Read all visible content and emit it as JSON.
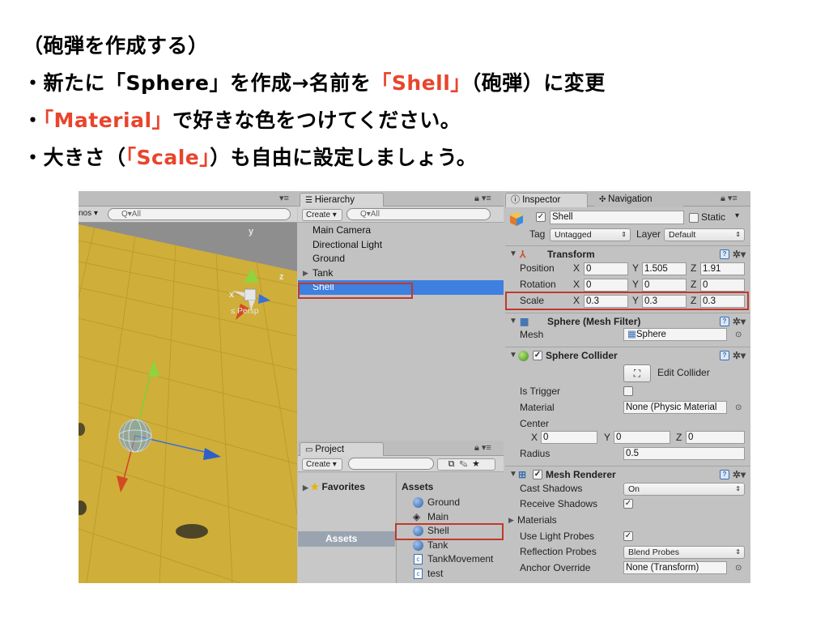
{
  "slide": {
    "heading": "（砲弾を作成する）",
    "bullet1": {
      "pre": "・新たに「Sphere」を作成→名前を",
      "hl": "「Shell」",
      "post": "（砲弾）に変更"
    },
    "bullet2": {
      "pre": "・",
      "hl": "「Material」",
      "post": "で好きな色をつけてください。"
    },
    "bullet3": {
      "pre": "・大きさ（",
      "hl": "「Scale」",
      "post": "）も自由に設定しましょう。"
    },
    "highlight_color": "#e8452c"
  },
  "scene": {
    "gizmos_label": "nos ▾",
    "search_placeholder": "Q▾All",
    "axis_y": "y",
    "axis_z": "z",
    "axis_x": "x",
    "persp_label": "≤ Persp"
  },
  "hierarchy": {
    "tab_label": "Hierarchy",
    "create_label": "Create ▾",
    "search_placeholder": "Q▾All",
    "items": [
      {
        "label": "Main Camera"
      },
      {
        "label": "Directional Light"
      },
      {
        "label": "Ground"
      },
      {
        "label": "Tank"
      },
      {
        "label": "Shell"
      }
    ]
  },
  "project": {
    "tab_label": "Project",
    "create_label": "Create ▾",
    "favorites_label": "Favorites",
    "assets_folder_label": "Assets",
    "assets_heading": "Assets",
    "items": [
      {
        "label": "Ground",
        "icon": "sphere-icon"
      },
      {
        "label": "Main",
        "icon": "unity-scene-icon"
      },
      {
        "label": "Shell",
        "icon": "sphere-icon"
      },
      {
        "label": "Tank",
        "icon": "sphere-icon"
      },
      {
        "label": "TankMovement",
        "icon": "script-icon"
      },
      {
        "label": "test",
        "icon": "script-icon"
      }
    ]
  },
  "inspector": {
    "tab_label": "Inspector",
    "nav_tab_label": "Navigation",
    "object_name": "Shell",
    "static_label": "Static",
    "tag_label": "Tag",
    "tag_value": "Untagged",
    "layer_label": "Layer",
    "layer_value": "Default",
    "transform": {
      "title": "Transform",
      "position_label": "Position",
      "rotation_label": "Rotation",
      "scale_label": "Scale",
      "position": {
        "x": "0",
        "y": "1.505",
        "z": "1.91"
      },
      "rotation": {
        "x": "0",
        "y": "0",
        "z": "0"
      },
      "scale": {
        "x": "0.3",
        "y": "0.3",
        "z": "0.3"
      }
    },
    "mesh_filter": {
      "title": "Sphere (Mesh Filter)",
      "mesh_label": "Mesh",
      "mesh_value": "Sphere"
    },
    "collider": {
      "title": "Sphere Collider",
      "edit_label": "Edit Collider",
      "is_trigger_label": "Is Trigger",
      "material_label": "Material",
      "material_value": "None (Physic Material",
      "center_label": "Center",
      "center": {
        "x": "0",
        "y": "0",
        "z": "0"
      },
      "radius_label": "Radius",
      "radius_value": "0.5"
    },
    "renderer": {
      "title": "Mesh Renderer",
      "cast_shadows_label": "Cast Shadows",
      "cast_shadows_value": "On",
      "receive_shadows_label": "Receive Shadows",
      "materials_label": "Materials",
      "light_probes_label": "Use Light Probes",
      "reflection_probes_label": "Reflection Probes",
      "reflection_probes_value": "Blend Probes",
      "anchor_override_label": "Anchor Override",
      "anchor_override_value": "None (Transform)"
    },
    "axes": {
      "x": "X",
      "y": "Y",
      "z": "Z"
    }
  }
}
